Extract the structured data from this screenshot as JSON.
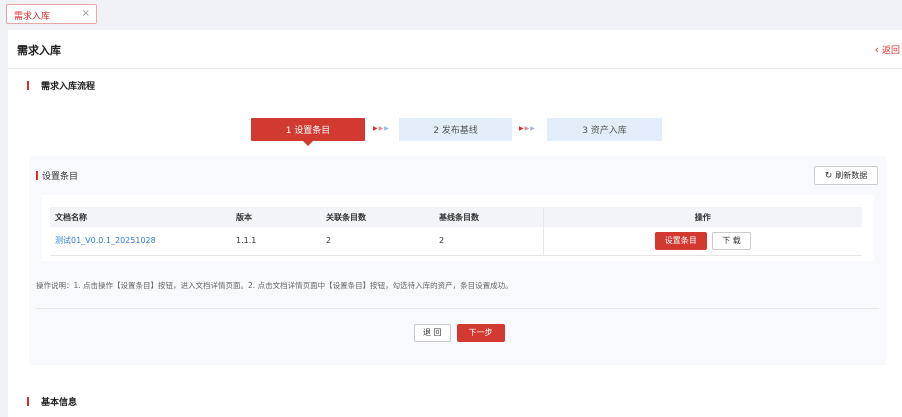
{
  "tabs": [
    {
      "label": "需求入库",
      "close": "×"
    }
  ],
  "page": {
    "title": "需求入库",
    "back_label": "返回"
  },
  "sections": {
    "flow_title": "需求入库流程",
    "basic_info_title": "基本信息"
  },
  "steps": [
    {
      "label": "1 设置条目",
      "active": true
    },
    {
      "label": "2 发布基线",
      "active": false
    },
    {
      "label": "3 资产入库",
      "active": false
    }
  ],
  "step_panel": {
    "title": "设置条目",
    "refresh_label": "刷新数据",
    "table": {
      "headers": [
        "文档名称",
        "版本",
        "关联条目数",
        "基线条目数",
        "操作"
      ],
      "rows": [
        {
          "name": "测试01_V0.0.1_20251028",
          "version": "1.1.1",
          "linked_count": "2",
          "baseline_count": "2",
          "action_primary": "设置条目",
          "action_secondary": "下 载"
        }
      ]
    },
    "note": "操作说明：1. 点击操作【设置条目】按钮，进入文档详情页面。2. 点击文档详情页面中【设置条目】按钮，勾选待入库的资产，条目设置成功。",
    "back_button": "退 回",
    "next_button": "下一步"
  },
  "colors": {
    "accent": "#d23a31",
    "step_inactive": "#e3edf9",
    "link": "#2f7fd6"
  },
  "icons": {
    "close": "close-icon",
    "back": "chevron-left-icon",
    "refresh": "refresh-icon",
    "step_arrow": "double-chevron-right-icon"
  }
}
